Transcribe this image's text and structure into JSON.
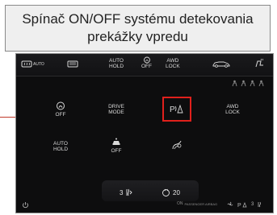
{
  "caption": {
    "text": "Spínač ON/OFF systému detekovania prekážky vpredu"
  },
  "topbar": {
    "items": [
      {
        "name": "rear-defrost-auto",
        "label": "AUTO",
        "icon": "rear-window-heat-icon"
      },
      {
        "name": "rear-window-heat",
        "label": "",
        "icon": "heated-rear-window-icon"
      },
      {
        "name": "auto-hold",
        "label": "AUTO\nHOLD",
        "icon": ""
      },
      {
        "name": "esp-off",
        "label": "OFF",
        "icon": "stability-control-icon"
      },
      {
        "name": "awd-lock",
        "label": "AWD\nLOCK",
        "icon": ""
      },
      {
        "name": "car-view",
        "label": "",
        "icon": "car-icon"
      },
      {
        "name": "settings",
        "label": "",
        "icon": "seat-heat-icon"
      }
    ]
  },
  "tiles": [
    {
      "name": "esp-off-tile",
      "label": "OFF",
      "icon": "stability-control-icon"
    },
    {
      "name": "drive-mode-tile",
      "label": "DRIVE\nMODE",
      "icon": ""
    },
    {
      "name": "front-obstacle-detection-tile",
      "label": "",
      "icon": "parking-sensor-icon"
    },
    {
      "name": "awd-lock-tile",
      "label": "AWD\nLOCK",
      "icon": ""
    },
    {
      "name": "auto-hold-tile",
      "label": "AUTO\nHOLD",
      "icon": ""
    },
    {
      "name": "descent-control-tile",
      "label": "OFF",
      "icon": "hill-descent-icon"
    },
    {
      "name": "lane-assist-tile",
      "label": "",
      "icon": "hand-wheel-icon"
    }
  ],
  "bottom": {
    "left_value": "3",
    "right_value": "20",
    "status_text": "PASSENGER AIRBAG"
  }
}
